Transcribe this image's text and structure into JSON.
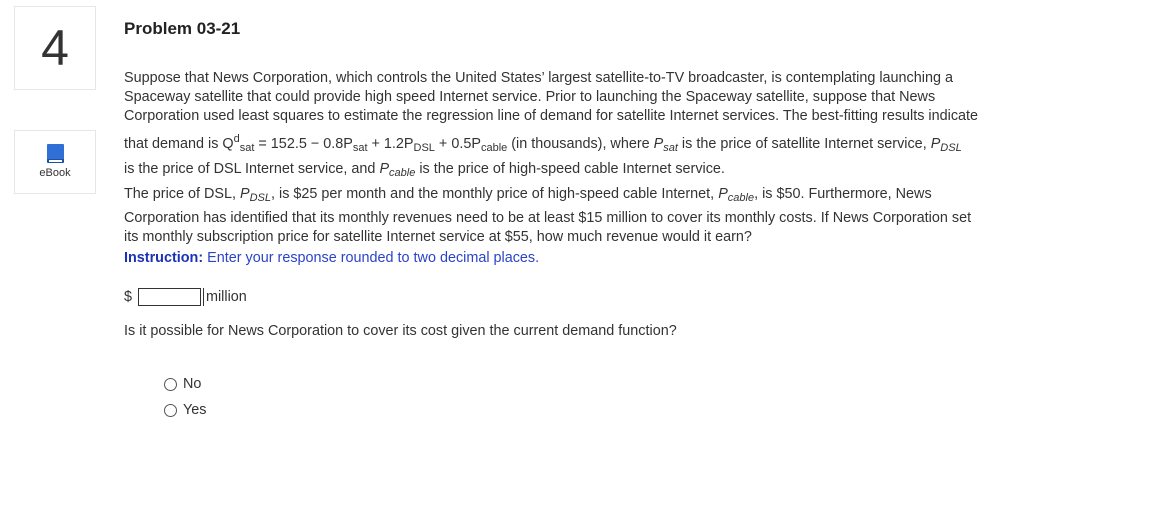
{
  "question": {
    "number": "4",
    "title": "Problem 03-21",
    "ebook_label": "eBook"
  },
  "body": {
    "line1": "Suppose that News Corporation, which controls the United States’ largest satellite-to-TV broadcaster, is contemplating launching a",
    "line2": "Spaceway satellite that could provide high speed Internet service. Prior to launching the Spaceway satellite, suppose that News",
    "line3": "Corporation used least squares to estimate the regression line of demand for satellite Internet services. The best-fitting results indicate",
    "eq_intro": "that demand is Q",
    "eq_sup_d": "d",
    "eq_sub_sat1": "sat",
    "eq_mid1": " = 152.5 − 0.8P",
    "eq_sub_sat2": "sat",
    "eq_mid2": " + 1.2P",
    "eq_sub_dsl": "DSL",
    "eq_mid3": " + 0.5P",
    "eq_sub_cable": "cable",
    "eq_tail1": " (in thousands), where ",
    "var_psat": "P",
    "var_psat_sub": "sat",
    "eq_tail2": " is the price of satellite Internet service, ",
    "var_pdsl": "P",
    "var_pdsl_sub": "DSL",
    "line5_a": "is the price of DSL Internet service, and ",
    "var_pcable": "P",
    "var_pcable_sub": "cable",
    "line5_b": " is the price of high-speed cable Internet service.",
    "line6_a": "The price of DSL, ",
    "line6_pdsl": "P",
    "line6_pdsl_sub": "DSL",
    "line6_b": ", is $25 per month and the monthly price of high-speed cable Internet, ",
    "line6_pcable": "P",
    "line6_pcable_sub": "cable",
    "line6_c": ", is $50. Furthermore, News",
    "line7": "Corporation has identified that its monthly revenues need to be at least $15 million to cover its monthly costs. If News Corporation set",
    "line8": "its monthly subscription price for satellite Internet service at $55, how much revenue would it earn?"
  },
  "instruction": {
    "label": "Instruction:",
    "text": " Enter your response rounded to two decimal places."
  },
  "answer": {
    "prefix": "$",
    "value": "",
    "unit": "million"
  },
  "question2": {
    "text": "Is it possible for News Corporation to cover its cost given the current demand function?",
    "options": [
      "No",
      "Yes"
    ]
  },
  "colors": {
    "instruction": "#2b43c8",
    "ebook_icon": "#2f6fd6"
  }
}
